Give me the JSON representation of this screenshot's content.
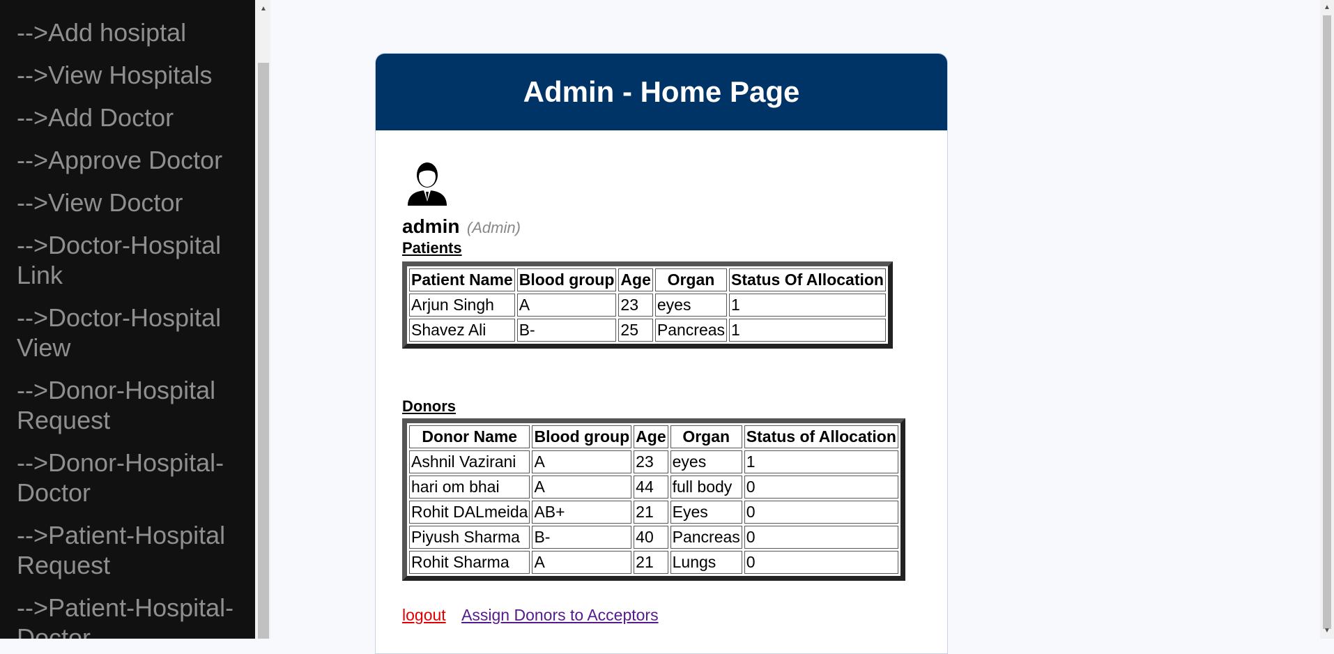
{
  "sidebar": {
    "items": [
      {
        "label": "-->Add hosiptal"
      },
      {
        "label": "-->View Hospitals"
      },
      {
        "label": "-->Add Doctor"
      },
      {
        "label": "-->Approve Doctor"
      },
      {
        "label": "-->View Doctor"
      },
      {
        "label": "-->Doctor-Hospital Link"
      },
      {
        "label": "-->Doctor-Hospital View"
      },
      {
        "label": "-->Donor-Hospital Request"
      },
      {
        "label": "-->Donor-Hospital-Doctor"
      },
      {
        "label": "-->Patient-Hospital Request"
      },
      {
        "label": "-->Patient-Hospital-Doctor"
      }
    ]
  },
  "header": {
    "title": "Admin - Home Page"
  },
  "user": {
    "name": "admin",
    "role": "(Admin)",
    "avatar_icon": "user-avatar-icon"
  },
  "patients": {
    "title": "Patients",
    "columns": [
      "Patient Name",
      "Blood group",
      "Age",
      "Organ",
      "Status Of Allocation"
    ],
    "rows": [
      [
        "Arjun Singh",
        "A",
        "23",
        "eyes",
        "1"
      ],
      [
        "Shavez Ali",
        "B-",
        "25",
        "Pancreas",
        "1"
      ]
    ]
  },
  "donors": {
    "title": "Donors",
    "columns": [
      "Donor Name",
      "Blood group",
      "Age",
      "Organ",
      "Status of Allocation"
    ],
    "rows": [
      [
        "Ashnil Vazirani",
        "A",
        "23",
        "eyes",
        "1"
      ],
      [
        "hari om bhai",
        "A",
        "44",
        "full body",
        "0"
      ],
      [
        "Rohit DALmeida",
        "AB+",
        "21",
        "Eyes",
        "0"
      ],
      [
        "Piyush Sharma",
        "B-",
        "40",
        "Pancreas",
        "0"
      ],
      [
        "Rohit Sharma",
        "A",
        "21",
        "Lungs",
        "0"
      ]
    ]
  },
  "links": {
    "logout": "logout",
    "assign": "Assign Donors to Acceptors"
  },
  "colors": {
    "header_bg": "#003366",
    "sidebar_bg": "#111111",
    "sidebar_text": "#8f8f8f",
    "logout": "#e00000",
    "assign": "#551a8b"
  }
}
